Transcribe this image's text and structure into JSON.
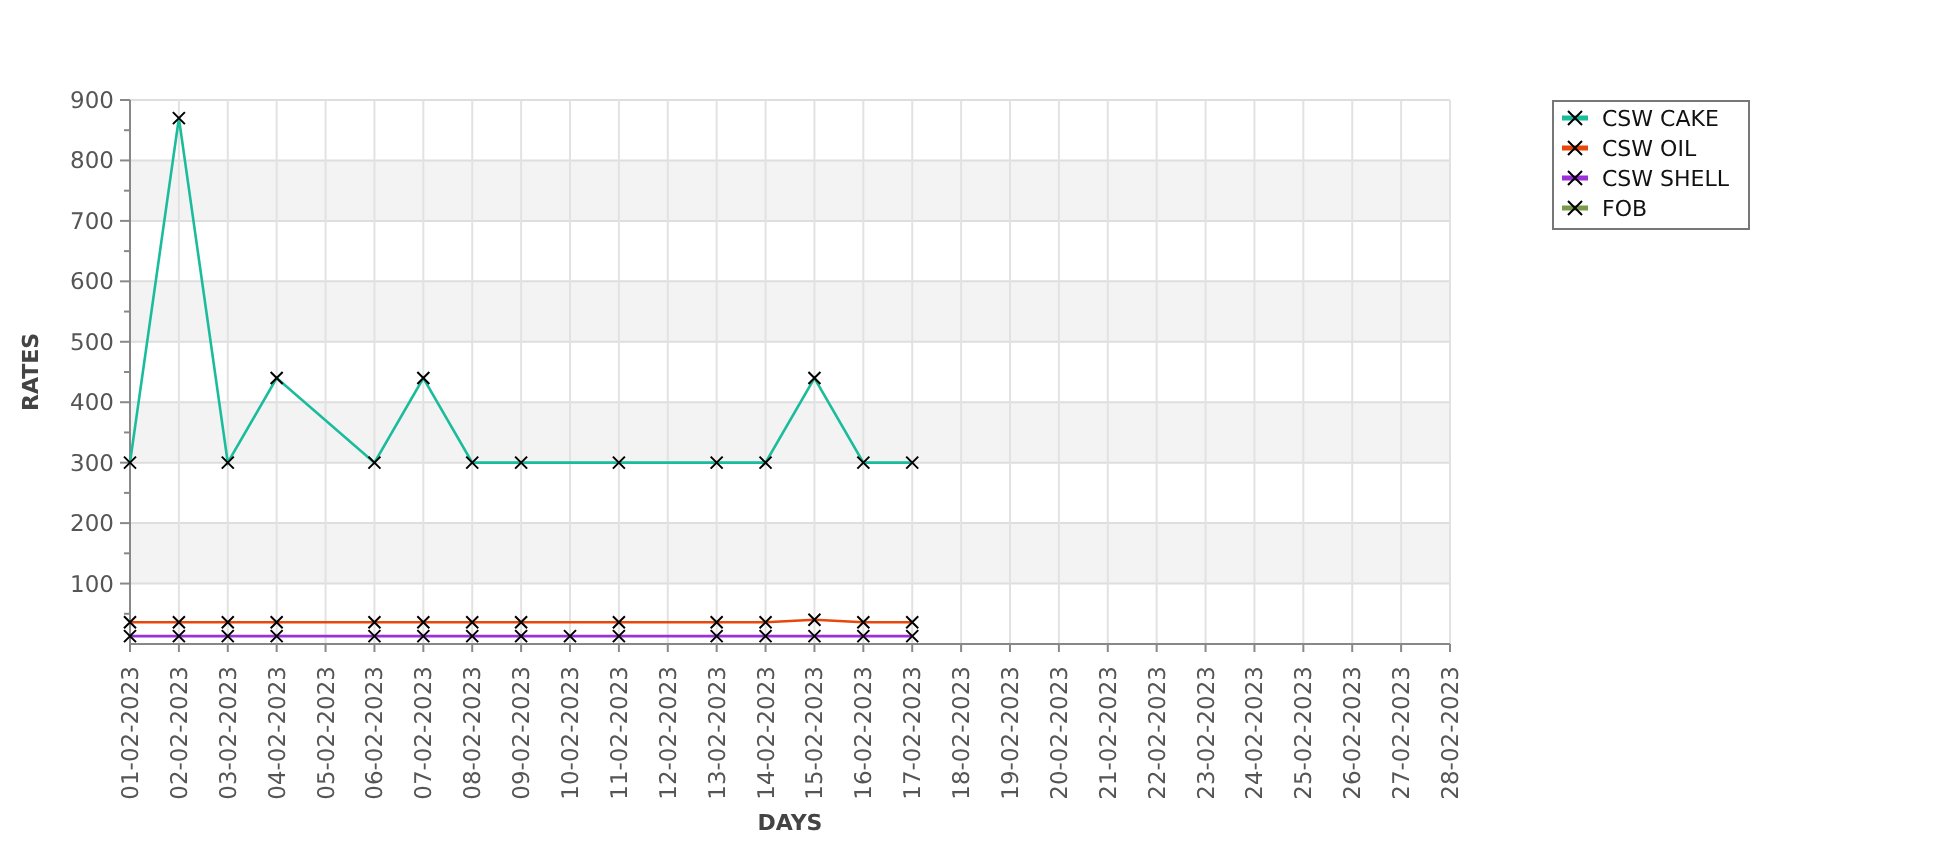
{
  "chart_data": {
    "type": "line",
    "xlabel": "DAYS",
    "ylabel": "RATES",
    "grid": true,
    "legend": true,
    "categories": [
      "01-02-2023",
      "02-02-2023",
      "03-02-2023",
      "04-02-2023",
      "05-02-2023",
      "06-02-2023",
      "07-02-2023",
      "08-02-2023",
      "09-02-2023",
      "10-02-2023",
      "11-02-2023",
      "12-02-2023",
      "13-02-2023",
      "14-02-2023",
      "15-02-2023",
      "16-02-2023",
      "17-02-2023",
      "18-02-2023",
      "19-02-2023",
      "20-02-2023",
      "21-02-2023",
      "22-02-2023",
      "23-02-2023",
      "24-02-2023",
      "25-02-2023",
      "26-02-2023",
      "27-02-2023",
      "28-02-2023"
    ],
    "series": [
      {
        "name": "CSW CAKE",
        "color": "#1abc9c",
        "marker": "x",
        "values": [
          300,
          870,
          300,
          440,
          null,
          300,
          440,
          300,
          300,
          null,
          300,
          null,
          300,
          300,
          440,
          300,
          300,
          null,
          null,
          null,
          null,
          null,
          null,
          null,
          null,
          null,
          null,
          null
        ]
      },
      {
        "name": "CSW OIL",
        "color": "#e8470b",
        "marker": "x",
        "values": [
          36,
          36,
          36,
          36,
          null,
          36,
          36,
          36,
          36,
          null,
          36,
          null,
          36,
          36,
          40,
          36,
          36,
          null,
          null,
          null,
          null,
          null,
          null,
          null,
          null,
          null,
          null,
          null
        ]
      },
      {
        "name": "CSW SHELL",
        "color": "#9b30d9",
        "marker": "x",
        "values": [
          13,
          13,
          13,
          13,
          null,
          13,
          13,
          13,
          13,
          13,
          13,
          null,
          13,
          13,
          13,
          13,
          13,
          null,
          null,
          null,
          null,
          null,
          null,
          null,
          null,
          null,
          null,
          null
        ]
      },
      {
        "name": "FOB",
        "color": "#7a9a4a",
        "marker": "x",
        "values": [
          null,
          null,
          null,
          null,
          null,
          null,
          null,
          null,
          null,
          null,
          null,
          null,
          null,
          null,
          null,
          null,
          null,
          null,
          null,
          null,
          null,
          null,
          null,
          null,
          null,
          null,
          null,
          null
        ]
      }
    ],
    "ylim": [
      0,
      900
    ],
    "yticks": [
      100,
      200,
      300,
      400,
      500,
      600,
      700,
      800,
      900
    ]
  }
}
